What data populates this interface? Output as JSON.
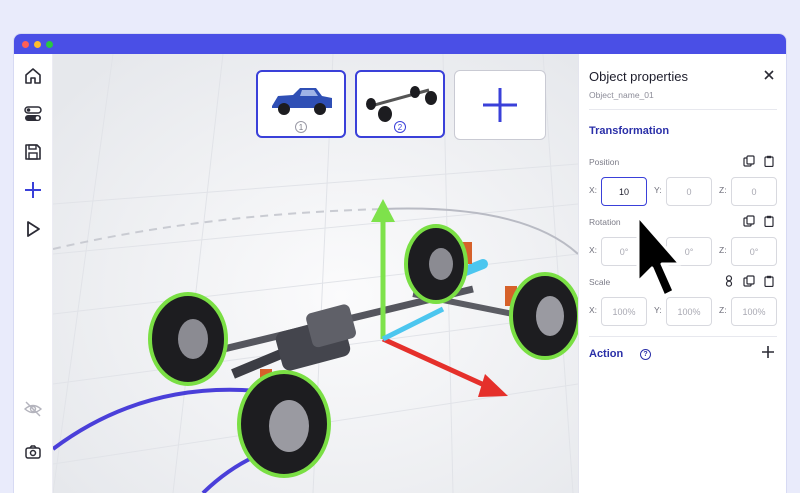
{
  "window": {
    "traffic_lights": [
      "#ff5f57",
      "#febc2e",
      "#28c840"
    ],
    "accent": "#4a4fe6"
  },
  "sidebar": {
    "items": [
      "home-icon",
      "toggle-icon",
      "save-icon",
      "add-icon",
      "play-icon",
      "hide-icon",
      "camera-rotate-icon"
    ]
  },
  "thumbnails": [
    {
      "number": "1",
      "selected": true
    },
    {
      "number": "2",
      "selected": true
    },
    {
      "add": true
    }
  ],
  "panel": {
    "title": "Object properties",
    "object_name": "Object_name_01",
    "section": "Transformation",
    "position": {
      "label": "Position",
      "x_axis": "X:",
      "y_axis": "Y:",
      "z_axis": "Z:",
      "x": "10",
      "y": "0",
      "z": "0"
    },
    "rotation": {
      "label": "Rotation",
      "x_axis": "X:",
      "y_axis": "Y:",
      "z_axis": "Z:",
      "x": "0°",
      "y": "0°",
      "z": "0°"
    },
    "scale": {
      "label": "Scale",
      "x_axis": "X:",
      "y_axis": "Y:",
      "z_axis": "Z:",
      "x": "100%",
      "y": "100%",
      "z": "100%"
    },
    "action": "Action",
    "help": "?"
  }
}
